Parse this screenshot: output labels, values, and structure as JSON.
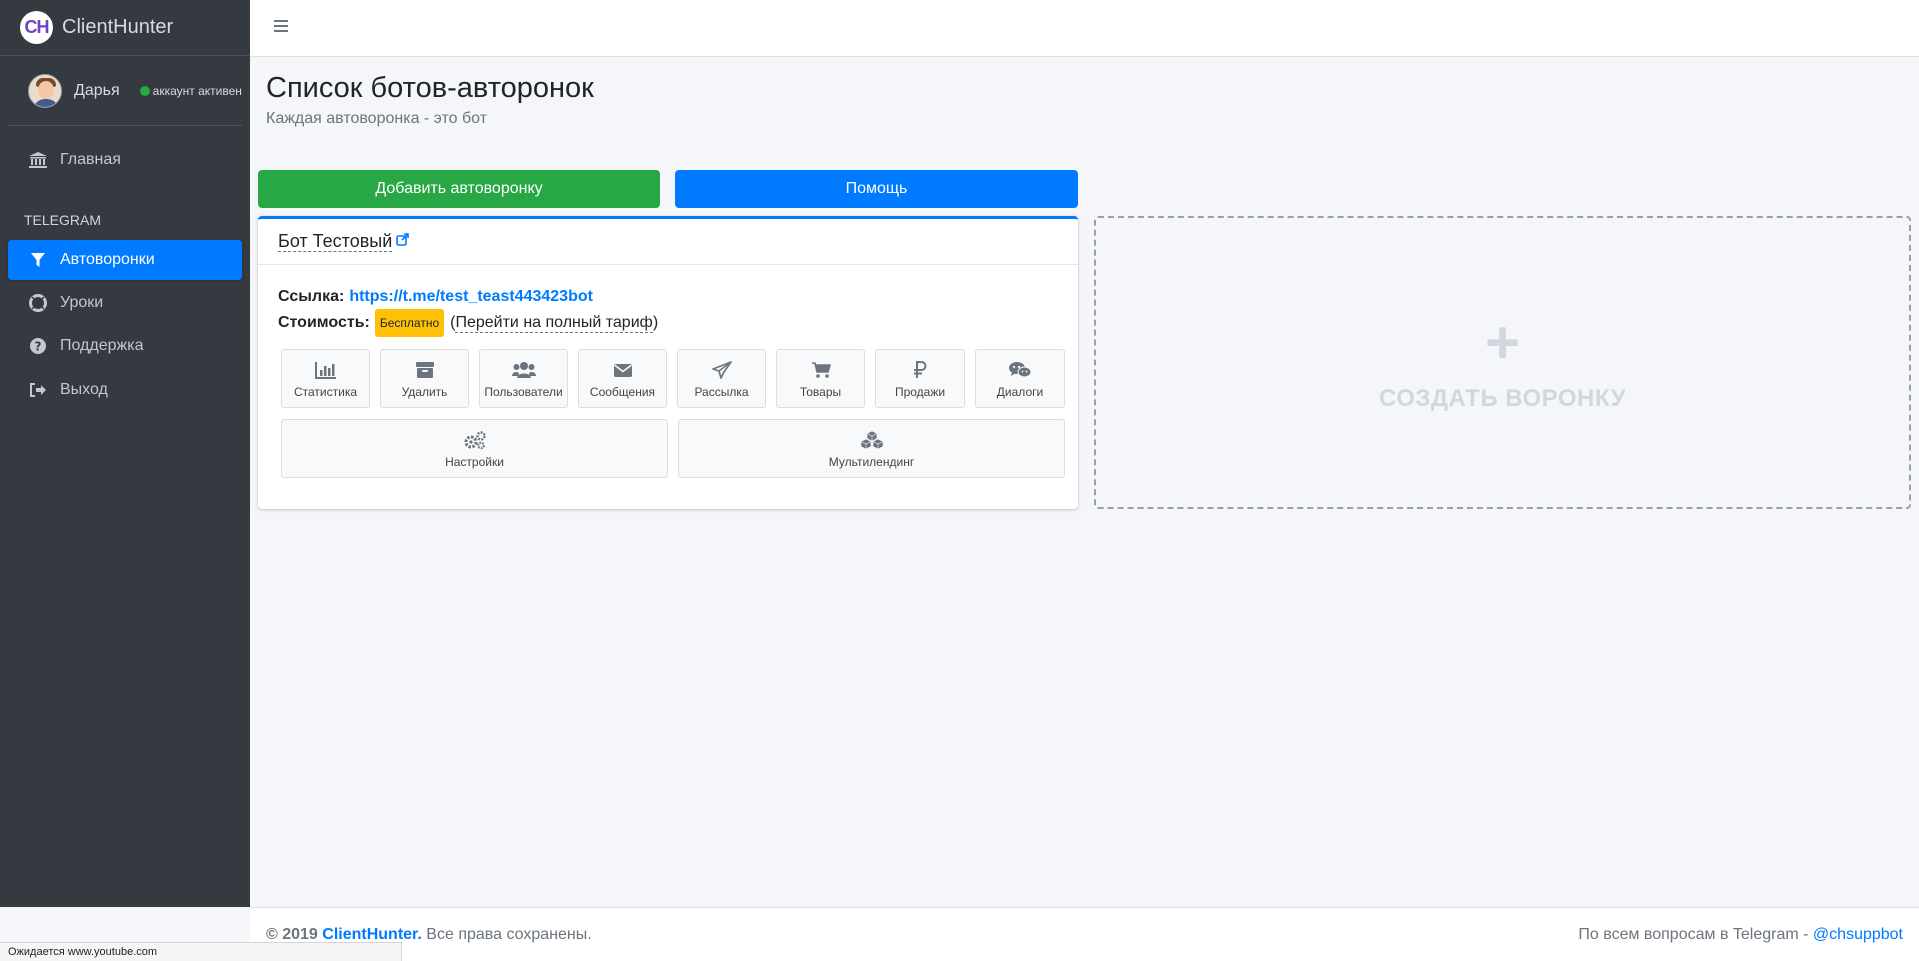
{
  "brand": {
    "logo_text": "CH",
    "name": "ClientHunter"
  },
  "user": {
    "name": "Дарья",
    "status": "аккаунт активен"
  },
  "sidebar": {
    "home": "Главная",
    "section_header": "TELEGRAM",
    "items": [
      {
        "label": "Автоворонки",
        "icon": "filter-icon",
        "active": true
      },
      {
        "label": "Уроки",
        "icon": "lifebuoy-icon"
      },
      {
        "label": "Поддержка",
        "icon": "question-circle-icon"
      },
      {
        "label": "Выход",
        "icon": "sign-out-icon"
      }
    ]
  },
  "page": {
    "title": "Список ботов-авторонок",
    "subtitle": "Каждая автоворонка - это бот"
  },
  "actions": {
    "add": "Добавить автоворонку",
    "help": "Помощь"
  },
  "bot": {
    "name": "Бот Тестовый",
    "link_label": "Ссылка:",
    "link": "https://t.me/test_teast443423bot",
    "cost_label": "Стоимость:",
    "cost_badge": "Бесплатно",
    "tariff_open": "(",
    "tariff_link": "Перейти на полный тариф",
    "tariff_close": ")",
    "tiles": [
      {
        "label": "Статистика",
        "icon": "bar-chart-icon"
      },
      {
        "label": "Удалить",
        "icon": "archive-icon"
      },
      {
        "label": "Пользователи",
        "icon": "users-icon"
      },
      {
        "label": "Сообщения",
        "icon": "envelope-icon"
      },
      {
        "label": "Рассылка",
        "icon": "paper-plane-icon"
      },
      {
        "label": "Товары",
        "icon": "cart-icon"
      },
      {
        "label": "Продажи",
        "icon": "ruble-icon"
      },
      {
        "label": "Диалоги",
        "icon": "chat-icon"
      }
    ],
    "wide_tiles": [
      {
        "label": "Настройки",
        "icon": "gears-icon"
      },
      {
        "label": "Мультилендинг",
        "icon": "cubes-icon"
      }
    ]
  },
  "create": {
    "plus": "+",
    "label": "СОЗДАТЬ ВОРОНКУ"
  },
  "footer": {
    "copyright": "© 2019",
    "brand": "ClientHunter.",
    "rights": "Все права сохранены.",
    "contact": "По всем вопросам в Telegram -",
    "handle": "@chsuppbot"
  },
  "browser_status": "Ожидается www.youtube.com",
  "colors": {
    "primary": "#007bff",
    "success": "#28a745",
    "sidebar": "#343a40",
    "badge": "#ffc107"
  }
}
